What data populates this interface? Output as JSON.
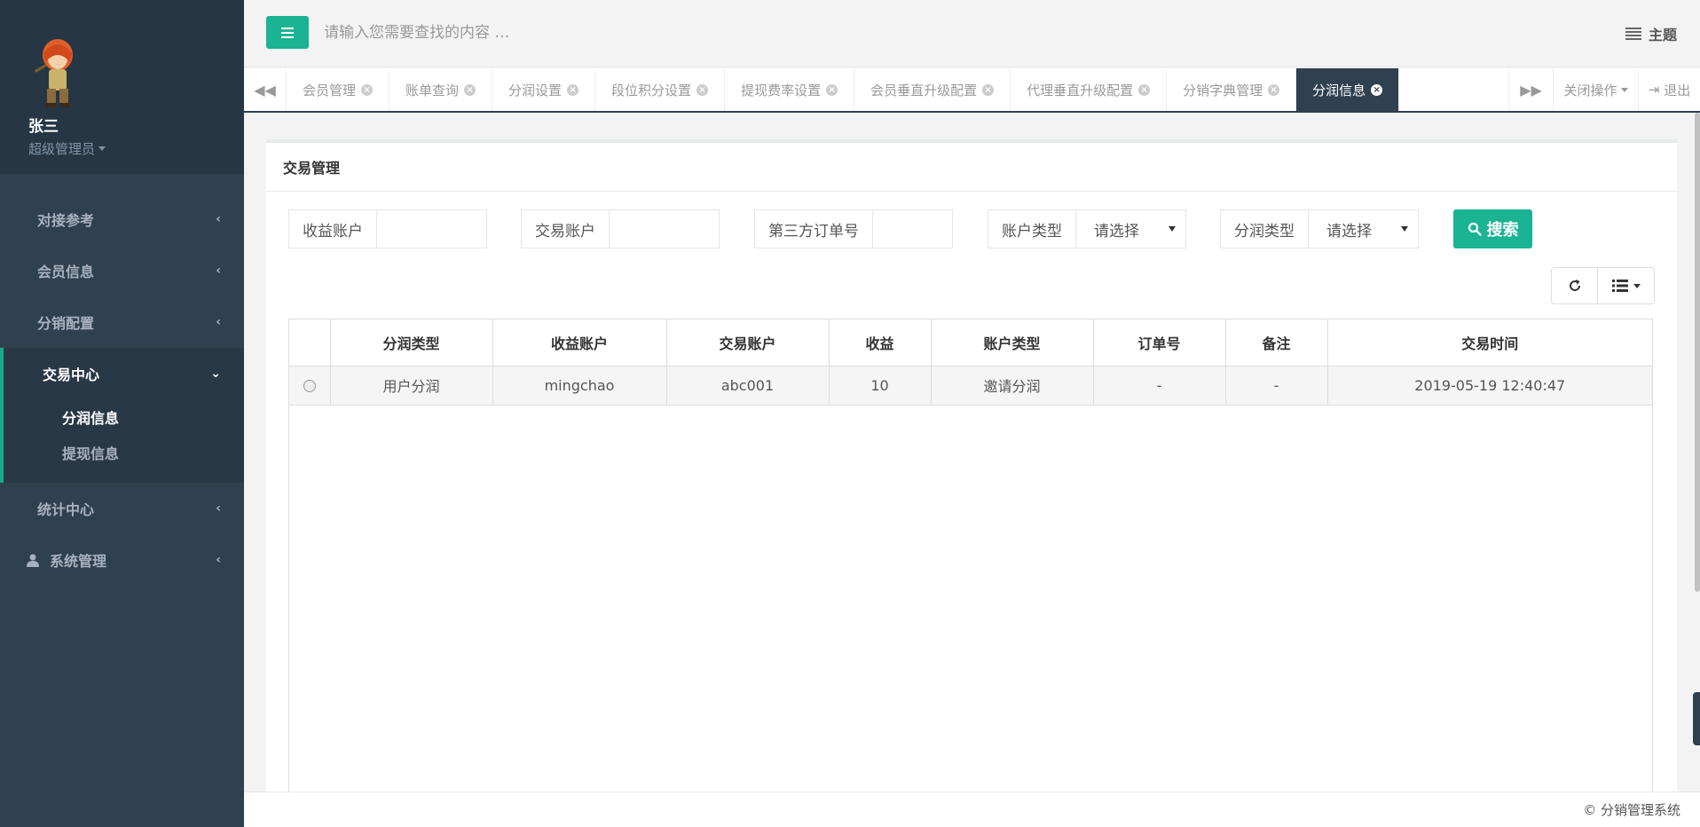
{
  "user": {
    "name": "张三",
    "role": "超级管理员"
  },
  "sidebar": {
    "items": [
      {
        "label": "对接参考"
      },
      {
        "label": "会员信息"
      },
      {
        "label": "分销配置"
      },
      {
        "label": "交易中心",
        "sub": [
          {
            "label": "分润信息"
          },
          {
            "label": "提现信息"
          }
        ]
      },
      {
        "label": "统计中心"
      },
      {
        "label": "系统管理"
      }
    ]
  },
  "header": {
    "search_placeholder": "请输入您需要查找的内容 …",
    "theme_label": "主题"
  },
  "tabs": [
    {
      "label": "会员管理"
    },
    {
      "label": "账单查询"
    },
    {
      "label": "分润设置"
    },
    {
      "label": "段位积分设置"
    },
    {
      "label": "提现费率设置"
    },
    {
      "label": "会员垂直升级配置"
    },
    {
      "label": "代理垂直升级配置"
    },
    {
      "label": "分销字典管理"
    },
    {
      "label": "分润信息"
    }
  ],
  "tab_controls": {
    "close_ops": "关闭操作",
    "logout": "退出"
  },
  "panel": {
    "title": "交易管理",
    "filters": {
      "income_account": "收益账户",
      "trade_account": "交易账户",
      "third_order": "第三方订单号",
      "account_type": "账户类型",
      "account_type_value": "请选择",
      "share_type": "分润类型",
      "share_type_value": "请选择",
      "search_label": "搜索"
    }
  },
  "table": {
    "headers": [
      "分润类型",
      "收益账户",
      "交易账户",
      "收益",
      "账户类型",
      "订单号",
      "备注",
      "交易时间"
    ],
    "rows": [
      [
        "用户分润",
        "mingchao",
        "abc001",
        "10",
        "邀请分润",
        "-",
        "-",
        "2019-05-19 12:40:47"
      ]
    ]
  },
  "footer": {
    "text": "© 分销管理系统"
  },
  "colors": {
    "sidebar": "#2f4050",
    "accent": "#1ab394"
  }
}
